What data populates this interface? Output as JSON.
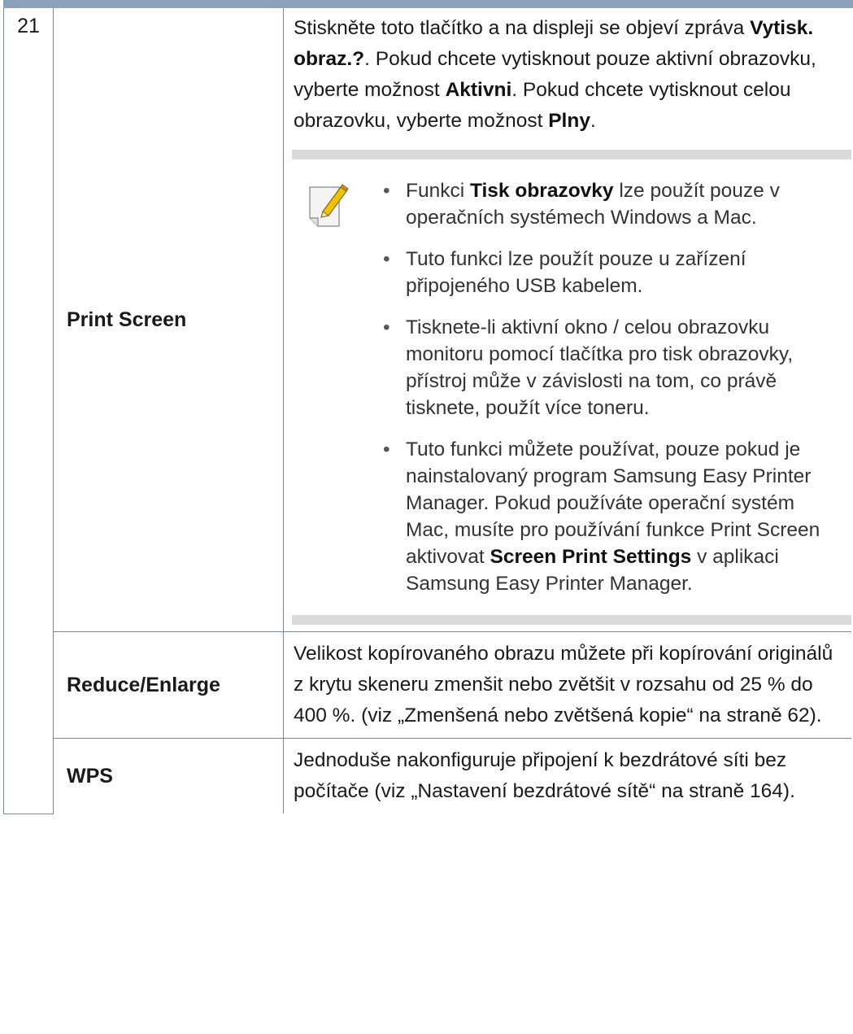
{
  "row_print_screen": {
    "number": "21",
    "label": "Print Screen",
    "desc_p1": "Stiskněte toto tlačítko a na displeji se objeví zpráva ",
    "desc_b1": "Vytisk. obraz.?",
    "desc_p2": ". Pokud chcete vytisknout pouze aktivní obrazovku, vyberte možnost ",
    "desc_b2": "Aktivni",
    "desc_p3": ". Pokud chcete vytisknout celou obrazovku, vyberte možnost ",
    "desc_b3": "Plny",
    "desc_p4": ".",
    "note_icon": "note-pencil-icon",
    "notes": {
      "n1_pre": "Funkci ",
      "n1_bold": "Tisk obrazovky",
      "n1_post": " lze použít pouze v operačních systémech Windows a Mac.",
      "n2": "Tuto funkci lze použít pouze u zařízení připojeného USB kabelem.",
      "n3": "Tisknete-li aktivní okno / celou obrazovku monitoru pomocí tlačítka pro tisk obrazovky, přístroj může v závislosti na tom, co právě tisknete, použít více toneru.",
      "n4_pre": "Tuto funkci můžete používat, pouze pokud je nainstalovaný program Samsung Easy Printer Manager. Pokud používáte operační systém Mac, musíte pro používání funkce Print Screen aktivovat ",
      "n4_bold": "Screen Print Settings",
      "n4_post": " v aplikaci Samsung Easy Printer Manager."
    }
  },
  "row_reduce_enlarge": {
    "label": "Reduce/Enlarge",
    "desc": "Velikost kopírovaného obrazu můžete při kopírování originálů z krytu skeneru zmenšit nebo zvětšit v rozsahu od 25 % do 400 %. (viz „Zmenšená nebo zvětšená kopie“ na straně 62)."
  },
  "row_wps": {
    "label": "WPS",
    "desc": "Jednoduše nakonfiguruje připojení k bezdrátové síti bez počítače (viz „Nastavení bezdrátové sítě“ na straně 164)."
  },
  "colors": {
    "top_rule": "#8ba0bb",
    "table_border": "#7a8a9a",
    "note_band": "#dadada"
  }
}
